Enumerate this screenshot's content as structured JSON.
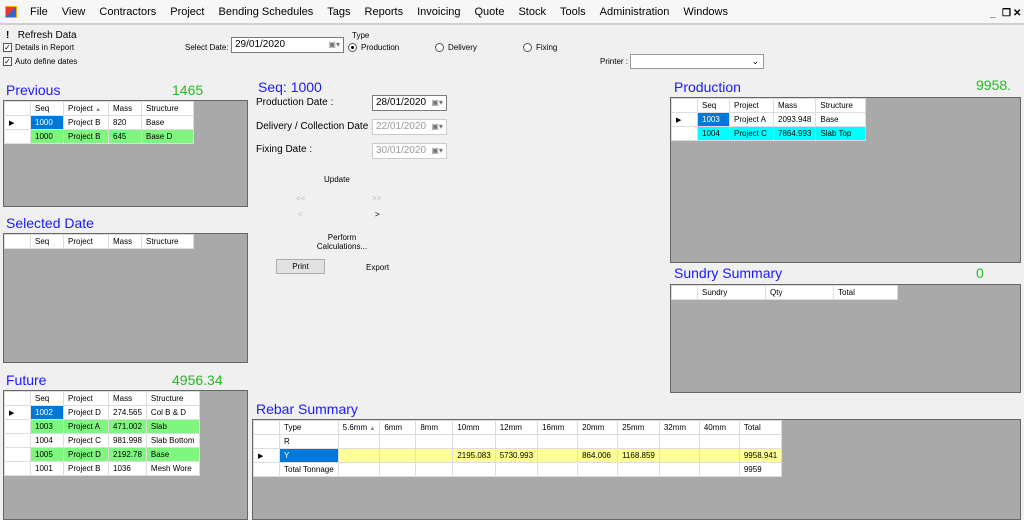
{
  "menu": [
    "File",
    "View",
    "Contractors",
    "Project",
    "Bending Schedules",
    "Tags",
    "Reports",
    "Invoicing",
    "Quote",
    "Stock",
    "Tools",
    "Administration",
    "Windows"
  ],
  "window_controls": {
    "minimize": "_",
    "restore": "❐",
    "close": "✕"
  },
  "toolbar": {
    "refresh_icon": "!",
    "refresh": "Refresh Data",
    "details_in_report": "Details in Report",
    "auto_define_dates": "Auto define dates",
    "select_date_label": "Select Date:",
    "select_date": "29/01/2020",
    "type_label": "Type",
    "types": [
      "Production",
      "Delivery",
      "Fixing"
    ],
    "selected_type": "Production",
    "printer_label": "Printer :",
    "printer": ""
  },
  "previous": {
    "title": "Previous",
    "total": "1465",
    "columns": [
      "Seq",
      "Project",
      "Mass",
      "Structure"
    ],
    "rows": [
      [
        "1000",
        "Project B",
        "820",
        "Base"
      ],
      [
        "1000",
        "Project B",
        "645",
        "Base D"
      ]
    ],
    "row_styles": [
      "",
      "green"
    ]
  },
  "selected_date": {
    "title": "Selected Date",
    "columns": [
      "Seq",
      "Project",
      "Mass",
      "Structure"
    ],
    "rows": []
  },
  "future": {
    "title": "Future",
    "total": "4956.34",
    "columns": [
      "Seq",
      "Project",
      "Mass",
      "Structure"
    ],
    "rows": [
      [
        "1002",
        "Project D",
        "274.565",
        "Col B & D"
      ],
      [
        "1003",
        "Project A",
        "471.002",
        "Slab"
      ],
      [
        "1004",
        "Project C",
        "981.998",
        "Slab Bottom"
      ],
      [
        "1005",
        "Project D",
        "2192.78",
        "Base"
      ],
      [
        "1001",
        "Project B",
        "1036",
        "Mesh Wore"
      ]
    ],
    "row_styles": [
      "",
      "green",
      "",
      "green",
      ""
    ]
  },
  "seq": {
    "title": "Seq: 1000",
    "production_date_label": "Production Date :",
    "production_date": "28/01/2020",
    "delivery_date_label": "Delivery / Collection Date :",
    "delivery_date": "22/01/2020",
    "fixing_date_label": "Fixing Date :",
    "fixing_date": "30/01/2020",
    "update": "Update",
    "first": "<<",
    "last": ">>",
    "prev": "<",
    "next": ">",
    "perform": "Perform Calculations...",
    "print": "Print",
    "export": "Export"
  },
  "production": {
    "title": "Production",
    "total": "9958.",
    "columns": [
      "Seq",
      "Project",
      "Mass",
      "Structure"
    ],
    "rows": [
      [
        "1003",
        "Project A",
        "2093.948",
        "Base"
      ],
      [
        "1004",
        "Project C",
        "7864.993",
        "Slab Top"
      ]
    ],
    "row_styles": [
      "",
      "cyan"
    ]
  },
  "sundry": {
    "title": "Sundry Summary",
    "total": "0",
    "columns": [
      "Sundry",
      "Qty",
      "Total"
    ],
    "rows": []
  },
  "rebar": {
    "title": "Rebar Summary",
    "columns": [
      "Type",
      "5.6mm",
      "6mm",
      "8mm",
      "10mm",
      "12mm",
      "16mm",
      "20mm",
      "25mm",
      "32mm",
      "40mm",
      "Total"
    ],
    "rows": [
      [
        "R",
        "",
        "",
        "",
        "",
        "",
        "",
        "",
        "",
        "",
        "",
        ""
      ],
      [
        "Y",
        "",
        "",
        "",
        "2195.083",
        "5730.993",
        "",
        "864.006",
        "1168.859",
        "",
        "",
        "9958.941"
      ],
      [
        "Total Tonnage",
        "",
        "",
        "",
        "",
        "",
        "",
        "",
        "",
        "",
        "",
        "9959"
      ]
    ],
    "row_styles": [
      "",
      "yellow",
      ""
    ]
  }
}
